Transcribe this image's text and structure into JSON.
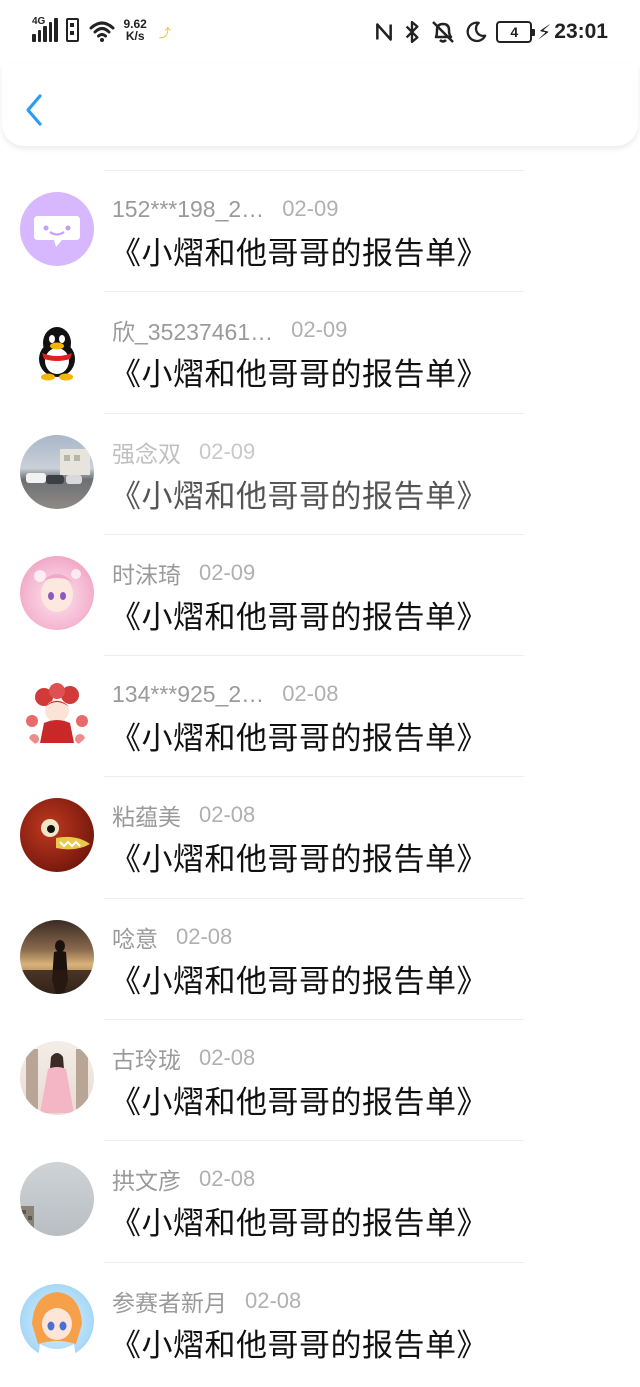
{
  "status_bar": {
    "network": "4G",
    "speed_value": "9.62",
    "speed_unit": "K/s",
    "battery": "4",
    "time": "23:01"
  },
  "nav": {
    "back_icon": "chevron-left-icon",
    "accent": "#2a9df4"
  },
  "list": {
    "items": [
      {
        "name": "152***198_2…",
        "date": "02-09",
        "title": "《小熠和他哥哥的报告单》",
        "avatar": "chat-bubble-avatar"
      },
      {
        "name": "欣_35237461…",
        "date": "02-09",
        "title": "《小熠和他哥哥的报告单》",
        "avatar": "penguin-avatar"
      },
      {
        "name": "强念双",
        "date": "02-09",
        "title": "《小熠和他哥哥的报告单》",
        "avatar": "street-photo-avatar"
      },
      {
        "name": "时沫琦",
        "date": "02-09",
        "title": "《小熠和他哥哥的报告单》",
        "avatar": "pink-anime-avatar"
      },
      {
        "name": "134***925_2…",
        "date": "02-08",
        "title": "《小熠和他哥哥的报告单》",
        "avatar": "red-chibi-avatar"
      },
      {
        "name": "粘蕴美",
        "date": "02-08",
        "title": "《小熠和他哥哥的报告单》",
        "avatar": "creature-avatar"
      },
      {
        "name": "唸意",
        "date": "02-08",
        "title": "《小熠和他哥哥的报告单》",
        "avatar": "sunset-silhouette-avatar"
      },
      {
        "name": "古玲珑",
        "date": "02-08",
        "title": "《小熠和他哥哥的报告单》",
        "avatar": "hanfu-girl-avatar"
      },
      {
        "name": "拱文彦",
        "date": "02-08",
        "title": "《小熠和他哥哥的报告单》",
        "avatar": "grey-sky-avatar"
      },
      {
        "name": "参赛者新月",
        "date": "02-08",
        "title": "《小熠和他哥哥的报告单》",
        "avatar": "orange-hair-anime-avatar"
      }
    ]
  }
}
